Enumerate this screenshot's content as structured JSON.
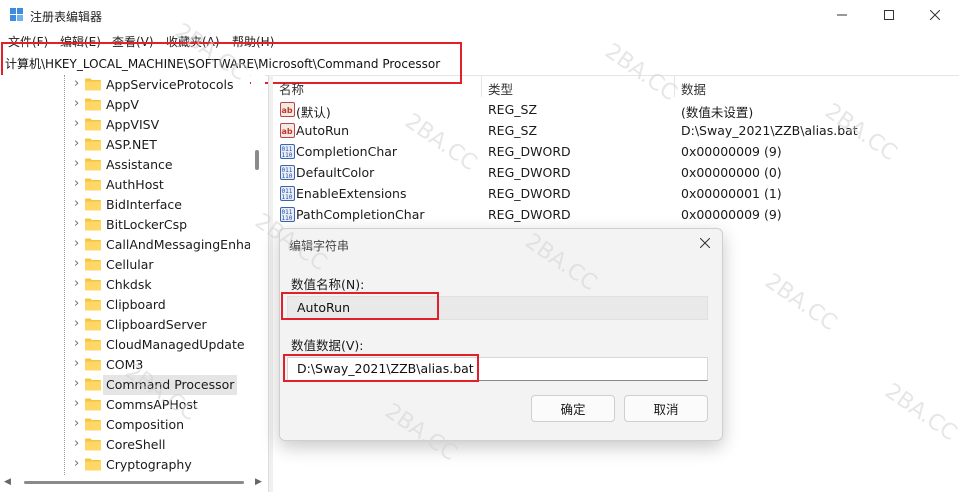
{
  "window": {
    "title": "注册表编辑器",
    "menu": [
      "文件(F)",
      "编辑(E)",
      "查看(V)",
      "收藏夹(A)",
      "帮助(H)"
    ]
  },
  "address": "计算机\\HKEY_LOCAL_MACHINE\\SOFTWARE\\Microsoft\\Command Processor",
  "tree": {
    "items": [
      {
        "label": "AppServiceProtocols",
        "selected": false
      },
      {
        "label": "AppV",
        "selected": false
      },
      {
        "label": "AppVISV",
        "selected": false
      },
      {
        "label": "ASP.NET",
        "selected": false
      },
      {
        "label": "Assistance",
        "selected": false
      },
      {
        "label": "AuthHost",
        "selected": false
      },
      {
        "label": "BidInterface",
        "selected": false
      },
      {
        "label": "BitLockerCsp",
        "selected": false
      },
      {
        "label": "CallAndMessagingEnhan",
        "selected": false
      },
      {
        "label": "Cellular",
        "selected": false
      },
      {
        "label": "Chkdsk",
        "selected": false
      },
      {
        "label": "Clipboard",
        "selected": false
      },
      {
        "label": "ClipboardServer",
        "selected": false
      },
      {
        "label": "CloudManagedUpdate",
        "selected": false
      },
      {
        "label": "COM3",
        "selected": false
      },
      {
        "label": "Command Processor",
        "selected": true
      },
      {
        "label": "CommsAPHost",
        "selected": false
      },
      {
        "label": "Composition",
        "selected": false
      },
      {
        "label": "CoreShell",
        "selected": false
      },
      {
        "label": "Cryptography",
        "selected": false
      }
    ]
  },
  "values": {
    "columns": [
      "名称",
      "类型",
      "数据"
    ],
    "rows": [
      {
        "icon": "string-value-icon",
        "name": "(默认)",
        "type": "REG_SZ",
        "data": "(数值未设置)"
      },
      {
        "icon": "string-value-icon",
        "name": "AutoRun",
        "type": "REG_SZ",
        "data": "D:\\Sway_2021\\ZZB\\alias.bat"
      },
      {
        "icon": "dword-value-icon",
        "name": "CompletionChar",
        "type": "REG_DWORD",
        "data": "0x00000009 (9)"
      },
      {
        "icon": "dword-value-icon",
        "name": "DefaultColor",
        "type": "REG_DWORD",
        "data": "0x00000000 (0)"
      },
      {
        "icon": "dword-value-icon",
        "name": "EnableExtensions",
        "type": "REG_DWORD",
        "data": "0x00000001 (1)"
      },
      {
        "icon": "dword-value-icon",
        "name": "PathCompletionChar",
        "type": "REG_DWORD",
        "data": "0x00000009 (9)"
      }
    ]
  },
  "dialog": {
    "title": "编辑字符串",
    "name_label": "数值名称(N):",
    "name_value": "AutoRun",
    "data_label": "数值数据(V):",
    "data_value": "D:\\Sway_2021\\ZZB\\alias.bat",
    "ok": "确定",
    "cancel": "取消"
  },
  "watermark": "2BA.CC",
  "colors": {
    "highlight_red": "#e0202a",
    "folder_yellow": "#f6c343",
    "selected_bg": "#e5e5e5"
  }
}
